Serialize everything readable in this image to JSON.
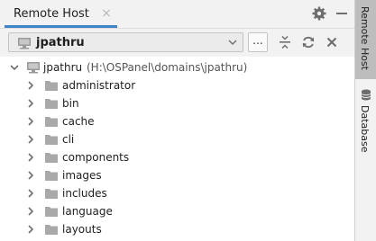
{
  "tab": {
    "title": "Remote Host",
    "close_glyph": "×"
  },
  "toolbar": {
    "server_selected": "jpathru",
    "browse_label": "...",
    "icons": [
      "server-icon",
      "chevron-down-icon",
      "collapse-all-icon",
      "refresh-icon",
      "close-icon"
    ]
  },
  "tree": {
    "root": {
      "name": "jpathru",
      "path": "(H:\\OSPanel\\domains\\jpathru)"
    },
    "items": [
      {
        "label": "administrator"
      },
      {
        "label": "bin"
      },
      {
        "label": "cache"
      },
      {
        "label": "cli"
      },
      {
        "label": "components"
      },
      {
        "label": "images"
      },
      {
        "label": "includes"
      },
      {
        "label": "language"
      },
      {
        "label": "layouts"
      }
    ]
  },
  "sidebar": {
    "items": [
      {
        "label": "Remote Host",
        "active": true
      },
      {
        "label": "Database",
        "active": false
      }
    ]
  },
  "colors": {
    "accent": "#4083c9",
    "folder": "#a9a9a9",
    "background": "#f2f2f2",
    "tree_bg": "#ffffff"
  }
}
